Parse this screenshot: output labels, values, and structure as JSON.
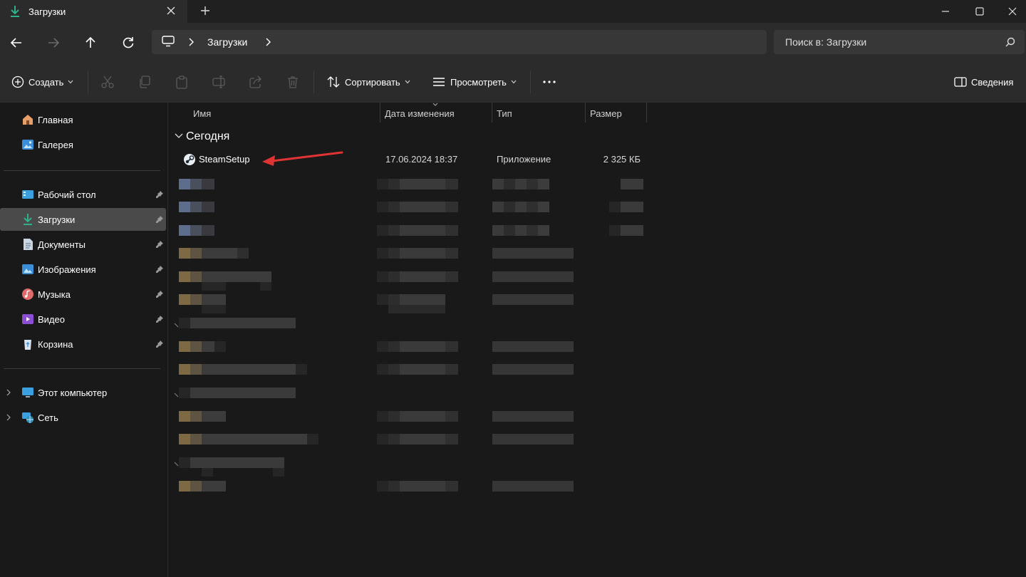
{
  "window": {
    "tab_title": "Загрузки",
    "tab_icon": "download-icon",
    "controls": [
      "minimize-icon",
      "maximize-icon",
      "close-icon"
    ]
  },
  "nav": {
    "buttons": [
      "back-icon",
      "forward-icon",
      "up-icon",
      "refresh-icon"
    ],
    "breadcrumb": [
      "Загрузки"
    ],
    "search_placeholder": "Поиск в: Загрузки"
  },
  "toolbar": {
    "create_label": "Создать",
    "sort_label": "Сортировать",
    "view_label": "Просмотреть",
    "details_label": "Сведения",
    "icons": [
      "cut-icon",
      "copy-icon",
      "paste-icon",
      "rename-icon",
      "share-icon",
      "delete-icon"
    ]
  },
  "sidebar": {
    "top": [
      {
        "label": "Главная",
        "icon": "home-icon"
      },
      {
        "label": "Галерея",
        "icon": "gallery-icon"
      }
    ],
    "pinned": [
      {
        "label": "Рабочий стол",
        "icon": "desktop-icon"
      },
      {
        "label": "Загрузки",
        "icon": "download-icon",
        "selected": true
      },
      {
        "label": "Документы",
        "icon": "documents-icon"
      },
      {
        "label": "Изображения",
        "icon": "pictures-icon"
      },
      {
        "label": "Музыка",
        "icon": "music-icon"
      },
      {
        "label": "Видео",
        "icon": "video-icon"
      },
      {
        "label": "Корзина",
        "icon": "recycle-bin-icon"
      }
    ],
    "bottom": [
      {
        "label": "Этот компьютер",
        "icon": "this-pc-icon"
      },
      {
        "label": "Сеть",
        "icon": "network-icon"
      }
    ]
  },
  "list": {
    "columns": [
      "Имя",
      "Дата изменения",
      "Тип",
      "Размер"
    ],
    "group_label": "Сегодня",
    "files": [
      {
        "name": "SteamSetup",
        "date": "17.06.2024 18:37",
        "type": "Приложение",
        "size": "2 325 КБ",
        "icon": "steam-icon"
      }
    ]
  },
  "colors": {
    "background": "#191919",
    "panel": "#2b2b2b",
    "selected": "#4a4a4a",
    "annotation_arrow": "#e03434"
  }
}
